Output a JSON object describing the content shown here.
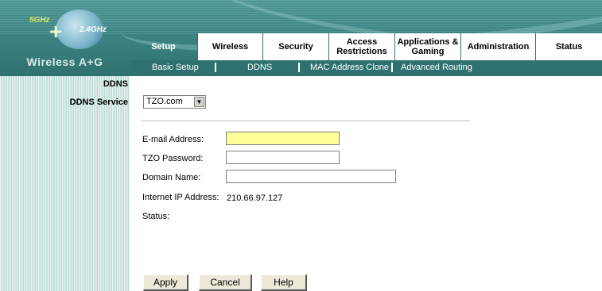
{
  "logo": {
    "band_5ghz": "5GHz",
    "band_24ghz": "2.4GHz",
    "mark": "+",
    "brand": "Wireless A+G"
  },
  "tabs": [
    {
      "label": "Setup",
      "active": true
    },
    {
      "label": "Wireless",
      "active": false
    },
    {
      "label": "Security",
      "active": false
    },
    {
      "label": "Access Restrictions",
      "active": false
    },
    {
      "label": "Applications & Gaming",
      "active": false
    },
    {
      "label": "Administration",
      "active": false
    },
    {
      "label": "Status",
      "active": false
    }
  ],
  "subnav": {
    "items": [
      "Basic Setup",
      "DDNS",
      "MAC Address Clone",
      "Advanced Routing"
    ],
    "active": "DDNS"
  },
  "sidebar": {
    "section_title": "DDNS",
    "subsection_title": "DDNS Service"
  },
  "form": {
    "service_select": {
      "value": "TZO.com",
      "options": [
        "TZO.com"
      ]
    },
    "email": {
      "label": "E-mail Address:",
      "value": "",
      "highlight": "#ffff99"
    },
    "password": {
      "label": "TZO Password:",
      "value": ""
    },
    "domain": {
      "label": "Domain Name:",
      "value": ""
    },
    "ip": {
      "label": "Internet IP Address:",
      "value": "210.66.97.127"
    },
    "status": {
      "label": "Status:",
      "value": ""
    }
  },
  "buttons": {
    "apply": "Apply",
    "cancel": "Cancel",
    "help": "Help"
  },
  "colors": {
    "header_teal": "#3d8483",
    "subnav_teal": "#2f7170",
    "sidebar_teal": "#cfe5e3"
  }
}
